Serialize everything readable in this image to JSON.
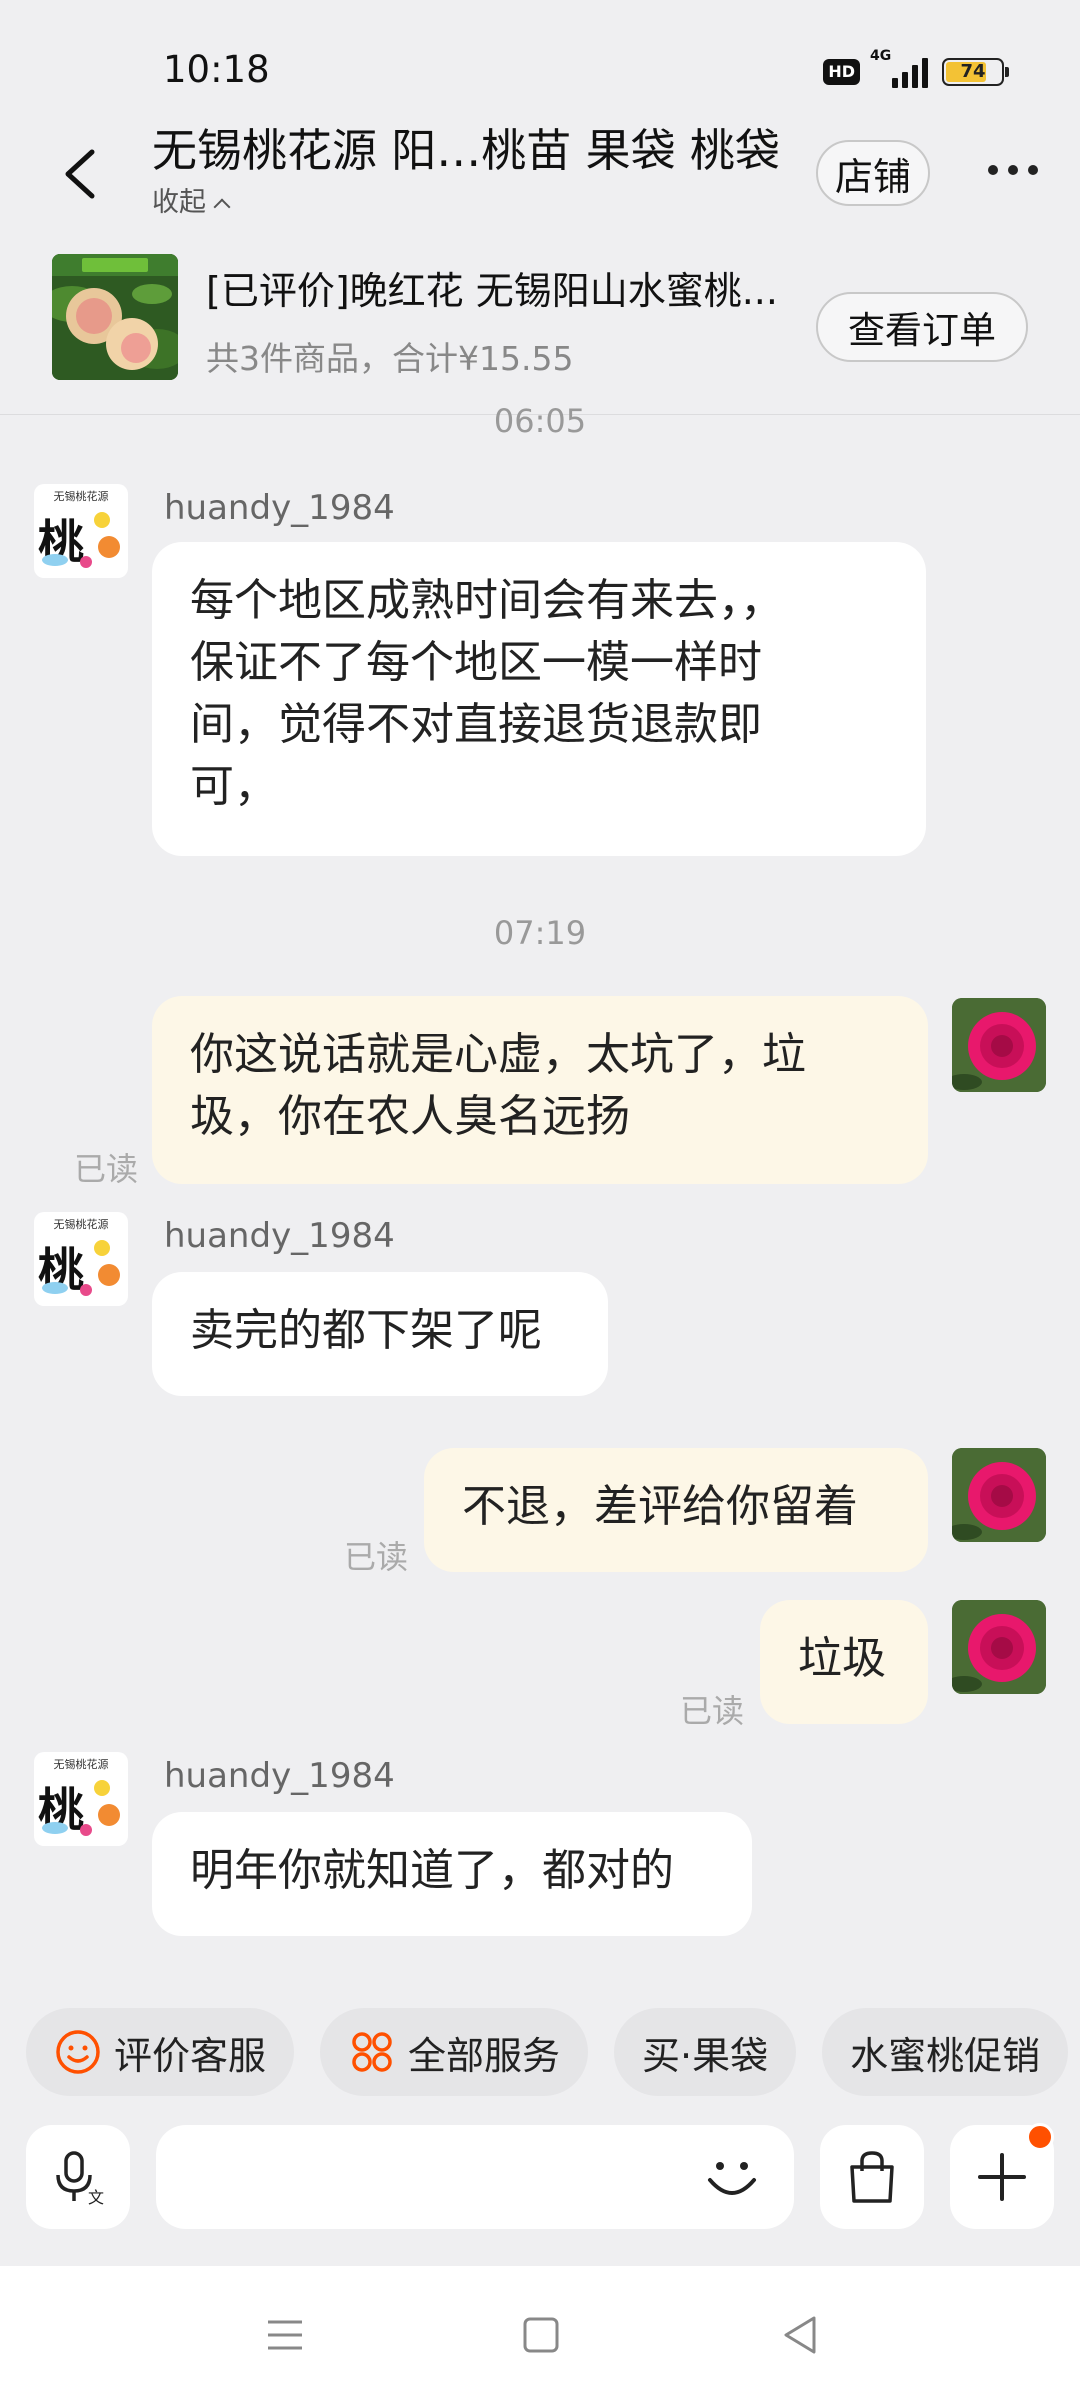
{
  "status_bar": {
    "time": "10:18",
    "hd": "HD",
    "network": "4G",
    "battery": "74",
    "battery_level": 0.74
  },
  "header": {
    "title": "无锡桃花源 阳…桃苗 果袋 桃袋",
    "collapse_label": "收起",
    "store_button": "店铺",
    "back_icon": "chevron-left-icon",
    "more_icon": "more-dots-icon"
  },
  "order": {
    "title": "[已评价]晚红花 无锡阳山水蜜桃...",
    "summary": "共3件商品，合计¥15.55",
    "button": "查看订单"
  },
  "messages": [
    {
      "type": "time",
      "text": "06:05"
    },
    {
      "type": "in",
      "sender": "huandy_1984",
      "lines": [
        "每个地区成熟时间会有来去，，",
        "保证不了每个地区一模一样时",
        "间，觉得不对直接退货退款即",
        "可，"
      ]
    },
    {
      "type": "time",
      "text": "07:19"
    },
    {
      "type": "out",
      "lines": [
        "你这说话就是心虚，太坑了，垃",
        "圾，你在农人臭名远扬"
      ],
      "read": "已读"
    },
    {
      "type": "in",
      "sender": "huandy_1984",
      "lines": [
        "卖完的都下架了呢"
      ]
    },
    {
      "type": "out",
      "lines": [
        "不退，差评给你留着"
      ],
      "read": "已读"
    },
    {
      "type": "out",
      "lines": [
        "垃圾"
      ],
      "read": "已读"
    },
    {
      "type": "in",
      "sender": "huandy_1984",
      "lines": [
        "明年你就知道了，都对的"
      ]
    }
  ],
  "seller_avatar": {
    "char": "桃",
    "top_text": "无锡桃花源"
  },
  "quick_chips": [
    {
      "label": "评价客服",
      "icon": "smile-icon"
    },
    {
      "label": "全部服务",
      "icon": "grid-icon"
    },
    {
      "label": "买·果袋",
      "icon": ""
    },
    {
      "label": "水蜜桃促销",
      "icon": ""
    }
  ],
  "input_bar": {
    "placeholder": "",
    "voice_icon": "voice-translate-icon",
    "emoji_icon": "emoji-icon",
    "bag_icon": "shopping-bag-icon",
    "plus_icon": "plus-icon"
  },
  "colors": {
    "background": "#efeff1",
    "outgoing_bubble": "#fdf7e7",
    "incoming_bubble": "#ffffff",
    "accent": "#ff5000"
  }
}
